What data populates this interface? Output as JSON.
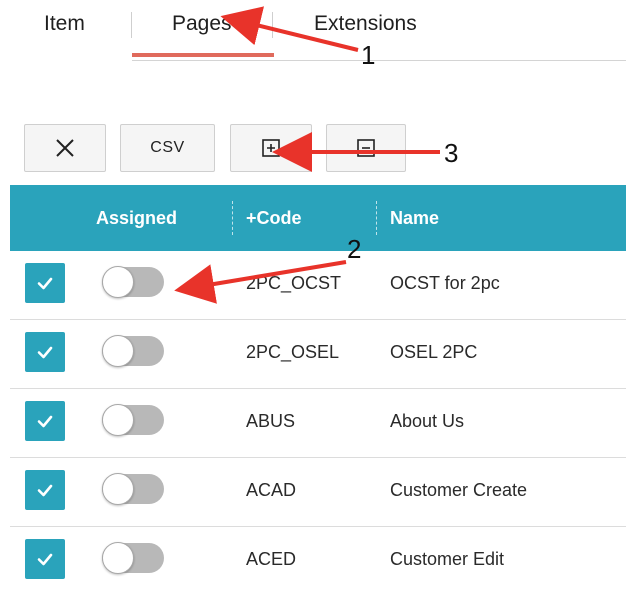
{
  "tabs": [
    {
      "label": "Item",
      "active": false
    },
    {
      "label": "Pages",
      "active": true
    },
    {
      "label": "Extensions",
      "active": false
    }
  ],
  "toolbar": {
    "close_icon": "close-icon",
    "csv_label": "CSV",
    "expand_icon": "plus-square-icon",
    "collapse_icon": "minus-square-icon"
  },
  "table": {
    "columns": {
      "assigned": "Assigned",
      "code": "+Code",
      "name": "Name"
    },
    "rows": [
      {
        "checked": true,
        "assigned": false,
        "code": "2PC_OCST",
        "name": "OCST for 2pc"
      },
      {
        "checked": true,
        "assigned": false,
        "code": "2PC_OSEL",
        "name": "OSEL 2PC"
      },
      {
        "checked": true,
        "assigned": false,
        "code": "ABUS",
        "name": "About Us"
      },
      {
        "checked": true,
        "assigned": false,
        "code": "ACAD",
        "name": "Customer Create"
      },
      {
        "checked": true,
        "assigned": false,
        "code": "ACED",
        "name": "Customer Edit"
      }
    ]
  },
  "annotations": {
    "label_1": "1",
    "label_2": "2",
    "label_3": "3",
    "arrow_color": "#e8332a"
  },
  "colors": {
    "accent": "#2aa3bb",
    "tab_underline": "#e06a5c"
  }
}
